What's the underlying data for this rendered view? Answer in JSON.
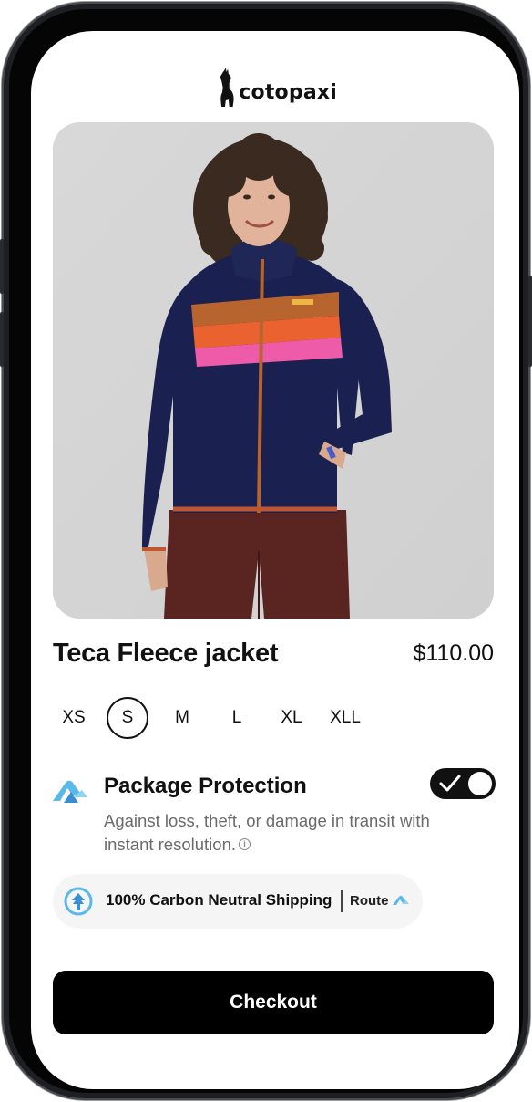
{
  "brand": {
    "name": "cotopaxi"
  },
  "product": {
    "title": "Teca Fleece jacket",
    "price": "$110.00",
    "image_alt": "Teca Fleece jacket"
  },
  "sizes": {
    "options": [
      "XS",
      "S",
      "M",
      "L",
      "XL",
      "XLL"
    ],
    "selected": "S"
  },
  "package_protection": {
    "title": "Package Protection",
    "description": "Against loss, theft, or damage in transit with instant resolution.",
    "info_icon": "ⓘ",
    "enabled": true
  },
  "carbon": {
    "text": "100% Carbon Neutral Shipping",
    "provider": "Route"
  },
  "checkout": {
    "label": "Checkout"
  },
  "colors": {
    "jacket": "#1a2150",
    "stripe_orange": "#e9622f",
    "stripe_pink": "#ee5ba8",
    "stripe_brown": "#b8642f",
    "route_blue": "#5bb8e8",
    "pants": "#5a2420"
  }
}
